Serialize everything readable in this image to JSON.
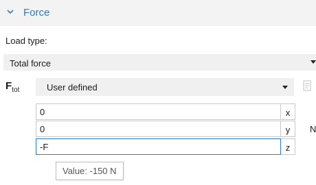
{
  "section": {
    "title": "Force",
    "icon": "chevron-down-icon"
  },
  "load_type": {
    "label": "Load type:",
    "selected": "Total force"
  },
  "ftot": {
    "symbol": "F",
    "subscript": "tot",
    "selected": "User defined"
  },
  "vector": [
    {
      "value": "0",
      "component": "x"
    },
    {
      "value": "0",
      "component": "y"
    },
    {
      "value": "-F",
      "component": "z"
    }
  ],
  "unit": "N",
  "tooltip": "Value: -150 N",
  "colors": {
    "accent": "#2b79c2",
    "focus_border": "#2c7be5"
  }
}
